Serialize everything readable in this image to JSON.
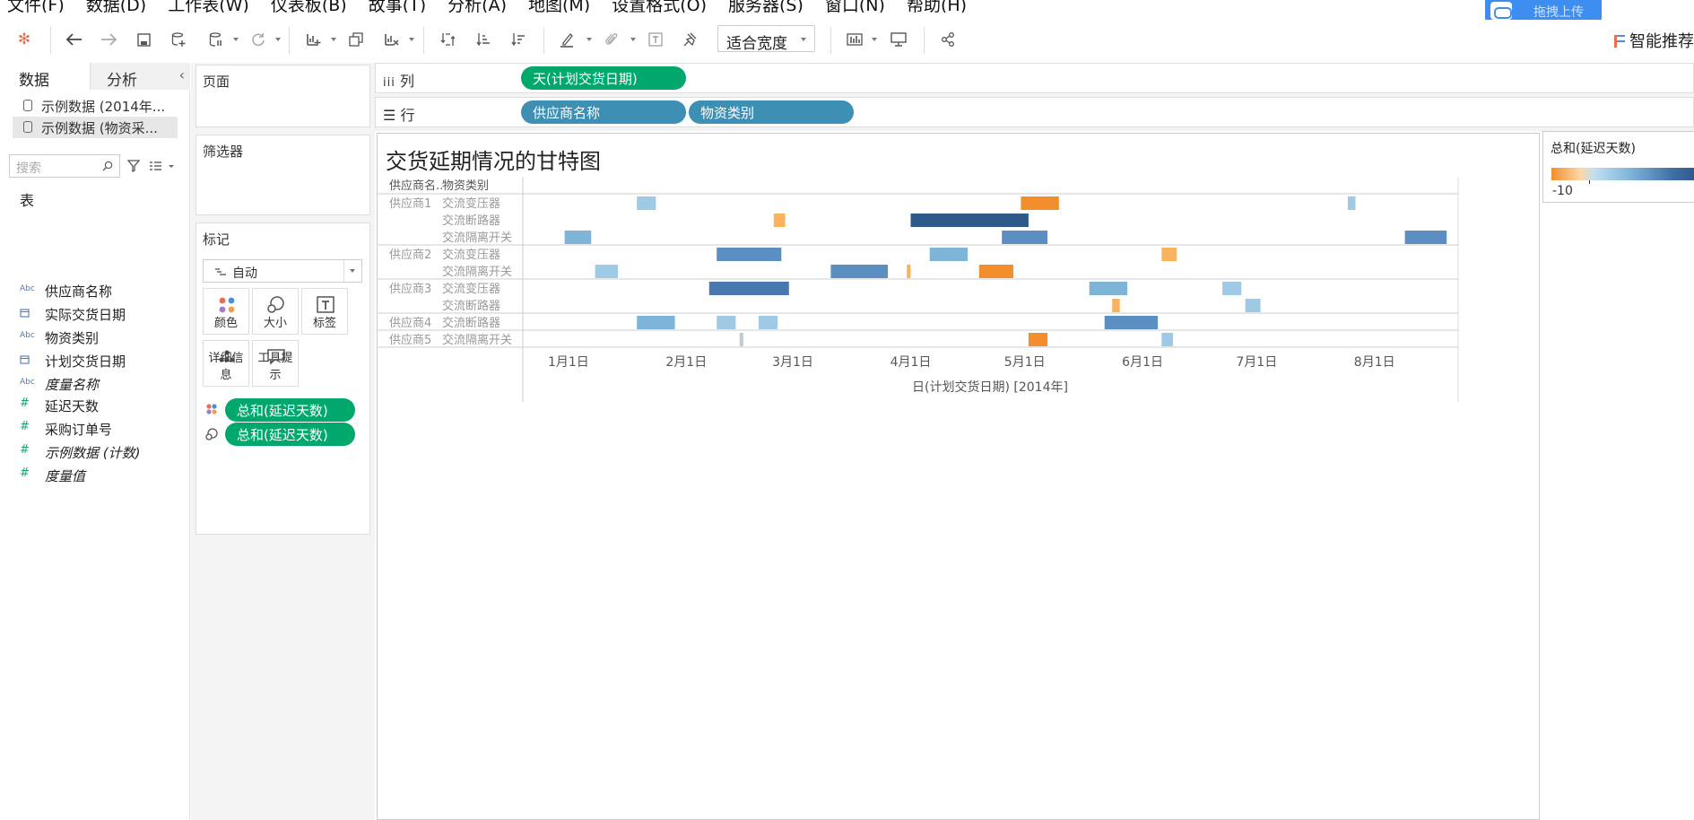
{
  "menu": [
    "文件(F)",
    "数据(D)",
    "工作表(W)",
    "仪表板(B)",
    "故事(T)",
    "分析(A)",
    "地图(M)",
    "设置格式(O)",
    "服务器(S)",
    "窗口(N)",
    "帮助(H)"
  ],
  "upload_label": "拖拽上传",
  "toolbar": {
    "fit_label": "适合宽度",
    "smart_rec": "智能推荐"
  },
  "left": {
    "tab_data": "数据",
    "tab_analysis": "分析",
    "datasources": [
      "示例数据 (2014年...",
      "示例数据 (物资采..."
    ],
    "search_placeholder": "搜索",
    "section": "表",
    "fields": [
      {
        "type": "Abc",
        "name": "供应商名称"
      },
      {
        "type": "date",
        "name": "实际交货日期"
      },
      {
        "type": "Abc",
        "name": "物资类别"
      },
      {
        "type": "date",
        "name": "计划交货日期"
      },
      {
        "type": "Abc",
        "name": "度量名称"
      },
      {
        "type": "#",
        "name": "延迟天数"
      },
      {
        "type": "#",
        "name": "采购订单号"
      },
      {
        "type": "#",
        "name": "示例数据 (计数)"
      },
      {
        "type": "#",
        "name": "度量值"
      }
    ]
  },
  "cards": {
    "pages": "页面",
    "filters": "筛选器",
    "marks": "标记",
    "mark_type": "自动",
    "buttons": [
      "颜色",
      "大小",
      "标签",
      "详细信息",
      "工具提示"
    ],
    "mark_pills": [
      "总和(延迟天数)",
      "总和(延迟天数)"
    ]
  },
  "shelves": {
    "columns_label": "列",
    "rows_label": "行",
    "columns_pills": [
      "天(计划交货日期)"
    ],
    "rows_pills": [
      "供应商名称",
      "物资类别"
    ]
  },
  "legend": {
    "title": "总和(延迟天数)",
    "min_label": "-10"
  },
  "chart_data": {
    "type": "gantt",
    "title": "交货延期情况的甘特图",
    "row_headers": [
      "供应商名..",
      "物资类别"
    ],
    "xlabel": "日(计划交货日期) [2014年]",
    "x_ticks": [
      "1月1日",
      "2月1日",
      "3月1日",
      "4月1日",
      "5月1日",
      "6月1日",
      "7月1日",
      "8月1日"
    ],
    "x_range": [
      "2013-12-20",
      "2014-08-23"
    ],
    "color_legend": "总和(延迟天数)",
    "rows": [
      {
        "supplier": "供应商1",
        "category": "交流变压器",
        "bars": [
          {
            "start": "2014-01-19",
            "days": 5,
            "delay": 3
          },
          {
            "start": "2014-04-30",
            "days": 10,
            "delay": -9
          },
          {
            "start": "2014-07-25",
            "days": 2,
            "delay": 1
          }
        ]
      },
      {
        "supplier": "",
        "category": "交流断路器",
        "bars": [
          {
            "start": "2014-02-24",
            "days": 3,
            "delay": -4
          },
          {
            "start": "2014-04-01",
            "days": 31,
            "delay": 16
          }
        ]
      },
      {
        "supplier": "",
        "category": "交流隔离开关",
        "bars": [
          {
            "start": "2013-12-31",
            "days": 7,
            "delay": 5
          },
          {
            "start": "2014-04-25",
            "days": 12,
            "delay": 9
          },
          {
            "start": "2014-08-09",
            "days": 11,
            "delay": 8
          }
        ]
      },
      {
        "supplier": "供应商2",
        "category": "交流变压器",
        "bars": [
          {
            "start": "2014-02-09",
            "days": 17,
            "delay": 11
          },
          {
            "start": "2014-04-06",
            "days": 10,
            "delay": 5
          },
          {
            "start": "2014-06-06",
            "days": 4,
            "delay": -5
          }
        ]
      },
      {
        "supplier": "",
        "category": "交流隔离开关",
        "bars": [
          {
            "start": "2014-01-08",
            "days": 6,
            "delay": 4
          },
          {
            "start": "2014-03-11",
            "days": 15,
            "delay": 10
          },
          {
            "start": "2014-03-31",
            "days": 1,
            "delay": -2
          },
          {
            "start": "2014-04-19",
            "days": 9,
            "delay": -9
          }
        ]
      },
      {
        "supplier": "供应商3",
        "category": "交流变压器",
        "bars": [
          {
            "start": "2014-02-07",
            "days": 21,
            "delay": 14
          },
          {
            "start": "2014-05-18",
            "days": 10,
            "delay": 6
          },
          {
            "start": "2014-06-22",
            "days": 5,
            "delay": 3
          }
        ]
      },
      {
        "supplier": "",
        "category": "交流断路器",
        "bars": [
          {
            "start": "2014-05-24",
            "days": 2,
            "delay": -3
          },
          {
            "start": "2014-06-28",
            "days": 4,
            "delay": 3
          }
        ]
      },
      {
        "supplier": "供应商4",
        "category": "交流断路器",
        "bars": [
          {
            "start": "2014-01-19",
            "days": 10,
            "delay": 6
          },
          {
            "start": "2014-02-09",
            "days": 5,
            "delay": 3
          },
          {
            "start": "2014-02-20",
            "days": 5,
            "delay": 4
          },
          {
            "start": "2014-05-22",
            "days": 14,
            "delay": 9
          }
        ]
      },
      {
        "supplier": "供应商5",
        "category": "交流隔离开关",
        "bars": [
          {
            "start": "2014-02-15",
            "days": 1,
            "delay": 0
          },
          {
            "start": "2014-05-02",
            "days": 5,
            "delay": -8
          },
          {
            "start": "2014-06-06",
            "days": 3,
            "delay": 2
          }
        ]
      }
    ]
  }
}
